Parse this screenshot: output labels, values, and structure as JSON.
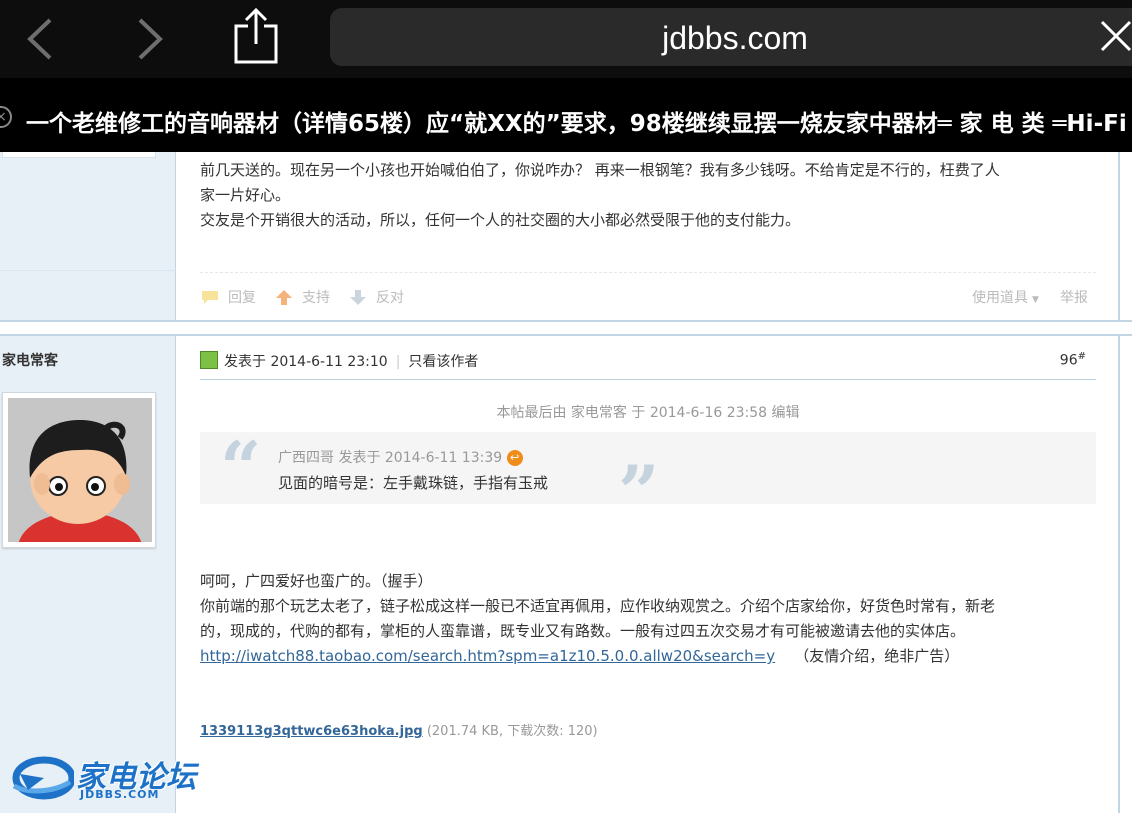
{
  "browser": {
    "url": "jdbbs.com",
    "tab_title": "一个老维修工的音响器材（详情65楼）应“就XX的”要求，98楼继续显摆一烧友家中器材═ 家 电 类 ═Hi-Fi"
  },
  "post_prev": {
    "lines": [
      "前几天送的。现在另一个小孩也开始喊伯伯了，你说咋办？ 再来一根钢笔？我有多少钱呀。不给肯定是不行的，枉费了人",
      "家一片好心。",
      "交友是个开销很大的活动，所以，任何一个人的社交圈的大小都必然受限于他的支付能力。"
    ],
    "actions": {
      "reply": "回复",
      "support": "支持",
      "oppose": "反对",
      "tools": "使用道具",
      "report": "举报"
    }
  },
  "post": {
    "author": "家电常客",
    "posted_on": "发表于 2014-6-11 23:10",
    "only_author": "只看该作者",
    "floor": "96",
    "floor_suffix": "#",
    "edit_note": "本帖最后由 家电常客 于 2014-6-16 23:58 编辑",
    "quote": {
      "author_line": "广西四哥 发表于 2014-6-11 13:39",
      "text": "见面的暗号是：左手戴珠链，手指有玉戒"
    },
    "body": [
      "呵呵，广四爱好也蛮广的。（握手）",
      "你前端的那个玩艺太老了，链子松成这样一般已不适宜再佩用，应作收纳观赏之。介绍个店家给你，好货色时常有，新老",
      "的，现成的，代购的都有，掌柜的人蛮靠谱，既专业又有路数。一般有过四五次交易才有可能被邀请去他的实体店。"
    ],
    "link": "http://iwatch88.taobao.com/search.htm?spm=a1z10.5.0.0.allw20&search=y",
    "link_note": "（友情介绍，绝非广告）",
    "attachment": {
      "name": "1339113g3qttwc6e63hoka.jpg",
      "meta": "(201.74 KB, 下载次数: 120)"
    }
  },
  "logo": {
    "text": "家电论坛",
    "sub": "JDBBS.COM"
  }
}
